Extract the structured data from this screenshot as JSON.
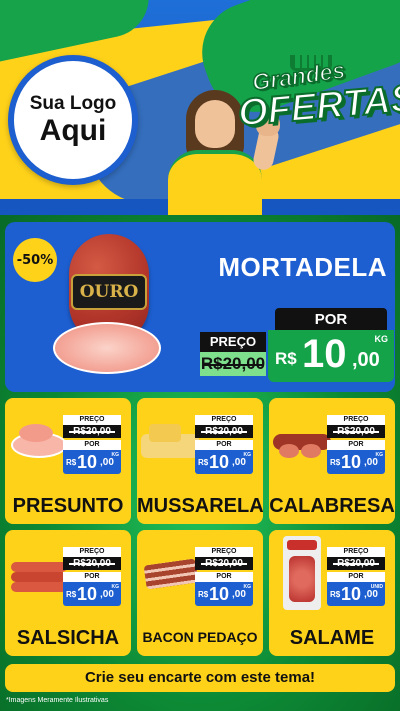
{
  "header": {
    "logo_line1": "Sua Logo",
    "logo_line2": "Aqui",
    "badge_line1": "Grandes",
    "badge_line2": "OFERTAS"
  },
  "featured": {
    "discount": "-50%",
    "name": "MORTADELA",
    "brand": "OURO",
    "por_label": "POR",
    "preco_label": "PREÇO",
    "old_price": "R$20,00",
    "new_currency": "R$",
    "new_int": "10",
    "new_dec": ",00",
    "unit": "KG"
  },
  "products": [
    {
      "name": "PRESUNTO",
      "preco_label": "PREÇO",
      "old_price": "R$20,00",
      "por_label": "POR",
      "currency": "R$",
      "int": "10",
      "dec": ",00",
      "unit": "KG"
    },
    {
      "name": "MUSSARELA",
      "preco_label": "PREÇO",
      "old_price": "R$20,00",
      "por_label": "POR",
      "currency": "R$",
      "int": "10",
      "dec": ",00",
      "unit": "KG"
    },
    {
      "name": "CALABRESA",
      "preco_label": "PREÇO",
      "old_price": "R$20,00",
      "por_label": "POR",
      "currency": "R$",
      "int": "10",
      "dec": ",00",
      "unit": "KG"
    },
    {
      "name": "SALSICHA",
      "preco_label": "PREÇO",
      "old_price": "R$20,00",
      "por_label": "POR",
      "currency": "R$",
      "int": "10",
      "dec": ",00",
      "unit": "KG"
    },
    {
      "name": "BACON PEDAÇO",
      "preco_label": "PREÇO",
      "old_price": "R$20,00",
      "por_label": "POR",
      "currency": "R$",
      "int": "10",
      "dec": ",00",
      "unit": "KG"
    },
    {
      "name": "SALAME",
      "preco_label": "PREÇO",
      "old_price": "R$20,00",
      "por_label": "POR",
      "currency": "R$",
      "int": "10",
      "dec": ",00",
      "unit": "UNID"
    }
  ],
  "cta": "Crie seu encarte com este tema!",
  "disclaimer": "*Imagens Meramente Ilustrativas",
  "colors": {
    "yellow": "#ffd21a",
    "blue": "#1d5fd1",
    "green": "#15a34a"
  }
}
